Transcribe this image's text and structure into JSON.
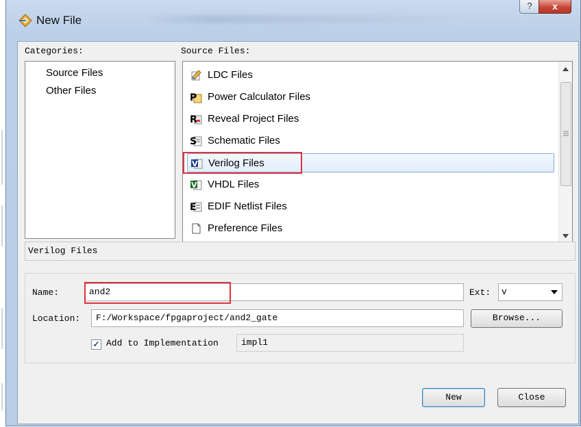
{
  "window": {
    "title": "New File",
    "help_glyph": "?",
    "close_glyph": "x"
  },
  "categories": {
    "label": "Categories:",
    "items": [
      "Source Files",
      "Other Files"
    ]
  },
  "source_files": {
    "label": "Source Files:",
    "items": [
      {
        "label": "LDC Files",
        "icon": "ldc-icon"
      },
      {
        "label": "Power Calculator Files",
        "icon": "power-calculator-icon"
      },
      {
        "label": "Reveal Project Files",
        "icon": "reveal-icon"
      },
      {
        "label": "Schematic Files",
        "icon": "schematic-icon"
      },
      {
        "label": "Verilog Files",
        "icon": "verilog-icon"
      },
      {
        "label": "VHDL Files",
        "icon": "vhdl-icon"
      },
      {
        "label": "EDIF Netlist Files",
        "icon": "edif-icon"
      },
      {
        "label": "Preference Files",
        "icon": "preference-icon"
      }
    ],
    "selected": "Verilog Files"
  },
  "description": "Verilog Files",
  "form": {
    "name_label": "Name:",
    "name_value": "and2",
    "ext_label": "Ext:",
    "ext_value": "v",
    "location_label": "Location:",
    "location_value": "F:/Workspace/fpgaproject/and2_gate",
    "browse_label": "Browse...",
    "add_impl_label": "Add to Implementation",
    "add_impl_checked": true,
    "impl_value": "impl1"
  },
  "buttons": {
    "new_label": "New",
    "close_label": "Close"
  },
  "colors": {
    "highlight_box": "#e0323c",
    "selection": "#84acdd"
  }
}
